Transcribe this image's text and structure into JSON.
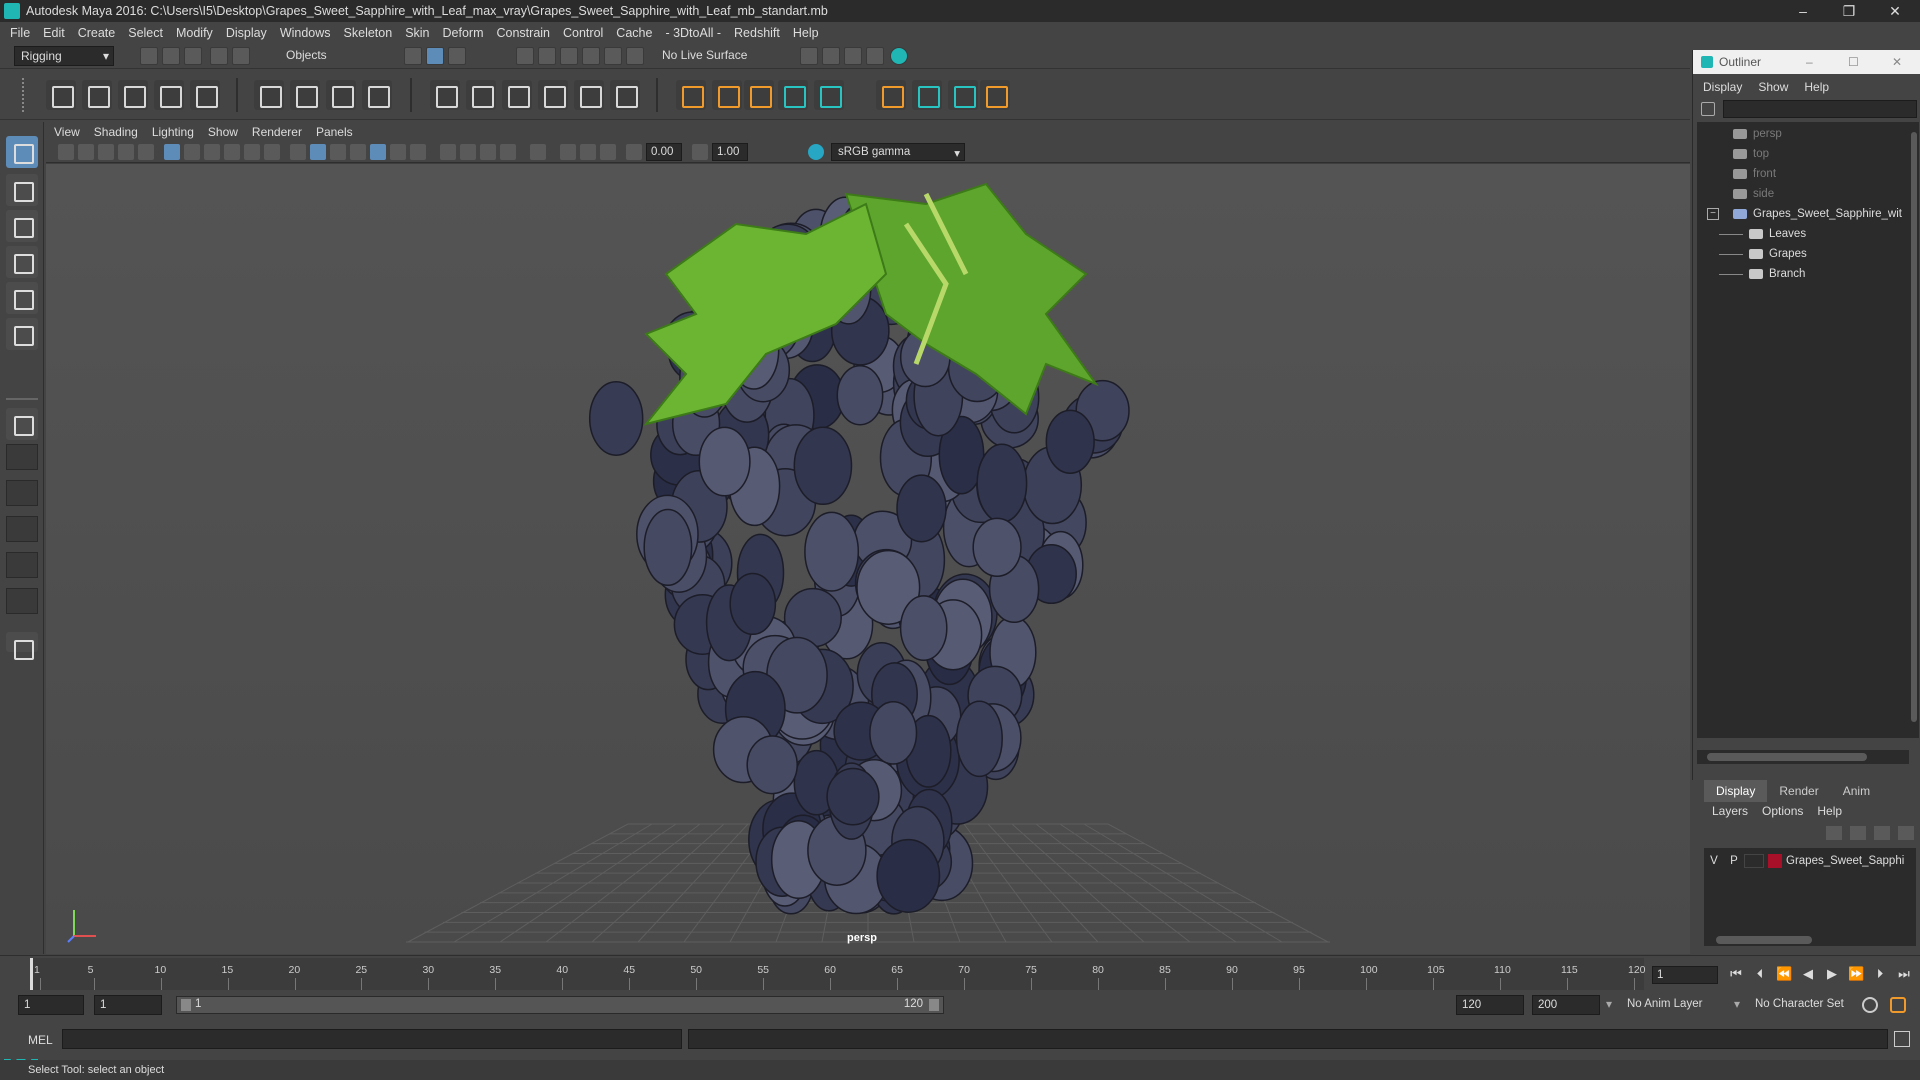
{
  "window": {
    "title": "Autodesk Maya 2016: C:\\Users\\I5\\Desktop\\Grapes_Sweet_Sapphire_with_Leaf_max_vray\\Grapes_Sweet_Sapphire_with_Leaf_mb_standart.mb",
    "minimize": "–",
    "restore": "❐",
    "close": "✕"
  },
  "menubar": [
    "File",
    "Edit",
    "Create",
    "Select",
    "Modify",
    "Display",
    "Windows",
    "Skeleton",
    "Skin",
    "Deform",
    "Constrain",
    "Control",
    "Cache",
    "- 3DtoAll -",
    "Redshift",
    "Help"
  ],
  "statusline": {
    "menuset": "Rigging",
    "selection_mode": "Objects",
    "live_surface": "No Live Surface"
  },
  "panel": {
    "menu": [
      "View",
      "Shading",
      "Lighting",
      "Show",
      "Renderer",
      "Panels"
    ],
    "exposure": "0.00",
    "gamma_value": "1.00",
    "color_space": "sRGB gamma",
    "camera": "persp"
  },
  "outliner": {
    "title": "Outliner",
    "menu": [
      "Display",
      "Show",
      "Help"
    ],
    "items": [
      {
        "label": "persp",
        "depth": 0,
        "dim": true,
        "icon": "camera-icon"
      },
      {
        "label": "top",
        "depth": 0,
        "dim": true,
        "icon": "camera-icon"
      },
      {
        "label": "front",
        "depth": 0,
        "dim": true,
        "icon": "camera-icon"
      },
      {
        "label": "side",
        "depth": 0,
        "dim": true,
        "icon": "camera-icon"
      },
      {
        "label": "Grapes_Sweet_Sapphire_wit",
        "depth": 0,
        "dim": false,
        "icon": "group-icon",
        "expand": "−"
      },
      {
        "label": "Leaves",
        "depth": 1,
        "dim": false,
        "icon": "mesh-icon"
      },
      {
        "label": "Grapes",
        "depth": 1,
        "dim": false,
        "icon": "mesh-icon"
      },
      {
        "label": "Branch",
        "depth": 1,
        "dim": false,
        "icon": "mesh-icon"
      }
    ]
  },
  "layers": {
    "tabs": [
      "Display",
      "Render",
      "Anim"
    ],
    "menu": [
      "Layers",
      "Options",
      "Help"
    ],
    "rows": [
      {
        "v": "V",
        "p": "P",
        "name": "Grapes_Sweet_Sapphi",
        "color": "#a8102a"
      }
    ]
  },
  "timeline": {
    "ticks": [
      "1",
      "5",
      "10",
      "15",
      "20",
      "25",
      "30",
      "35",
      "40",
      "45",
      "50",
      "55",
      "60",
      "65",
      "70",
      "75",
      "80",
      "85",
      "90",
      "95",
      "100",
      "105",
      "110",
      "115",
      "120"
    ],
    "current_frame": "1"
  },
  "range": {
    "start": "1",
    "playback_start": "1",
    "slider_start": "1",
    "slider_end": "120",
    "playback_end": "120",
    "end": "200",
    "anim_layer": "No Anim Layer",
    "character_set": "No Character Set"
  },
  "cmdline": {
    "label": "MEL"
  },
  "helpline": "Select Tool: select an object",
  "colors": {
    "accent": "#1fb6b4",
    "leaf": "#5da52c",
    "grape": "#3b3f56"
  }
}
